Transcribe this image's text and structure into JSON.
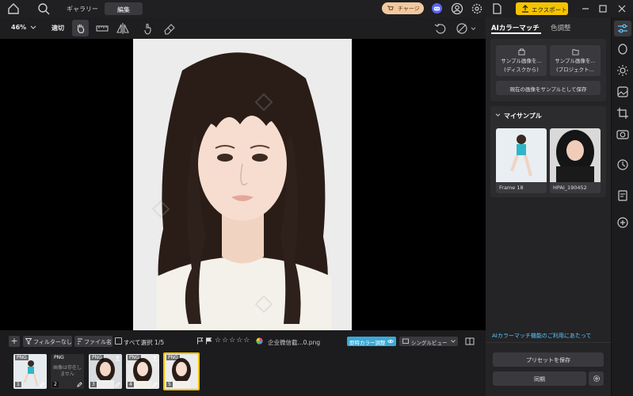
{
  "titlebar": {
    "tab_gallery": "ギャラリー",
    "tab_edit": "編集",
    "charge_label": "チャージ",
    "export_label": "エクスポート"
  },
  "toolbar": {
    "zoom": "46%",
    "fit_label": "適切"
  },
  "canvas": {
    "photo_description_icon": "portrait-photo"
  },
  "bottom": {
    "filter_label": "フィルターなし",
    "sort_label": "ファイル名",
    "select_all_label": "すべて選択 1/5",
    "filename": "企业微信截...0.png",
    "realtime_label": "即時カラー調整",
    "view_label": "シングルビュー",
    "thumbs": [
      {
        "badge": "PNG",
        "index": "1",
        "text": ""
      },
      {
        "badge": "PNG",
        "index": "2",
        "text": "画像は存在しません"
      },
      {
        "badge": "PNG",
        "index": "3",
        "text": ""
      },
      {
        "badge": "PNG",
        "index": "4",
        "text": ""
      },
      {
        "badge": "PNG",
        "index": "5",
        "text": ""
      }
    ]
  },
  "rightpanel": {
    "tab_ai": "AIカラーマッチ",
    "tab_color": "色調整",
    "sample_disk": "サンプル画像を...\n(ディスクから)",
    "sample_project": "サンプル画像を...\n(プロジェクト...",
    "save_current": "現在の画像をサンプルとして保存",
    "my_samples": "マイサンプル",
    "sample1_name": "Frame 18",
    "sample2_name": "HPAI_190452",
    "about_link": "AIカラーマッチ機能のご利用にあたって",
    "save_preset": "プリセットを保存",
    "sync": "同期"
  },
  "colors": {
    "accent": "#5cc8ff",
    "export": "#f5c400",
    "charge": "#f2c9a0",
    "thumb_border": "#f5c400"
  }
}
